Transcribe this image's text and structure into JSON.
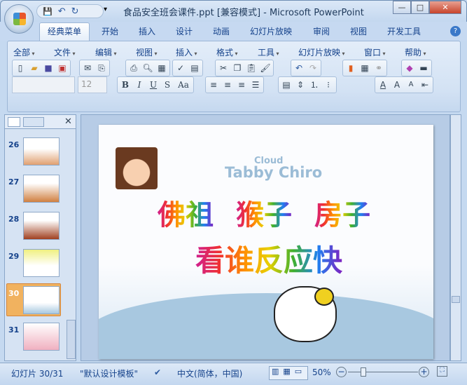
{
  "window": {
    "title": "食品安全班会课件.ppt [兼容模式] - Microsoft PowerPoint",
    "min": "—",
    "max": "□",
    "close": "✕"
  },
  "qat": {
    "save": "💾",
    "undo": "↶",
    "redo": "↻",
    "more": "▾"
  },
  "tabs": [
    "经典菜单",
    "开始",
    "插入",
    "设计",
    "动画",
    "幻灯片放映",
    "审阅",
    "视图",
    "开发工具"
  ],
  "help": "?",
  "menus": [
    "全部",
    "文件",
    "编辑",
    "视图",
    "插入",
    "格式",
    "工具",
    "幻灯片放映",
    "窗口",
    "帮助"
  ],
  "font": {
    "name": "",
    "size": "12"
  },
  "format_buttons": [
    "B",
    "I",
    "U",
    "S",
    "Aa"
  ],
  "panel": {
    "close": "✕"
  },
  "thumbnails": [
    {
      "num": "26"
    },
    {
      "num": "27"
    },
    {
      "num": "28"
    },
    {
      "num": "29"
    },
    {
      "num": "30",
      "selected": true
    },
    {
      "num": "31"
    }
  ],
  "slide": {
    "brand_small": "Cloud",
    "brand": "Tabby Chiro",
    "line1": [
      "佛祖",
      "猴子",
      "房子"
    ],
    "line2": "看谁反应快"
  },
  "status": {
    "slide": "幻灯片 30/31",
    "template": "\"默认设计模板\"",
    "language": "中文(简体，中国)",
    "zoom": "50%",
    "zoom_value": 50
  }
}
